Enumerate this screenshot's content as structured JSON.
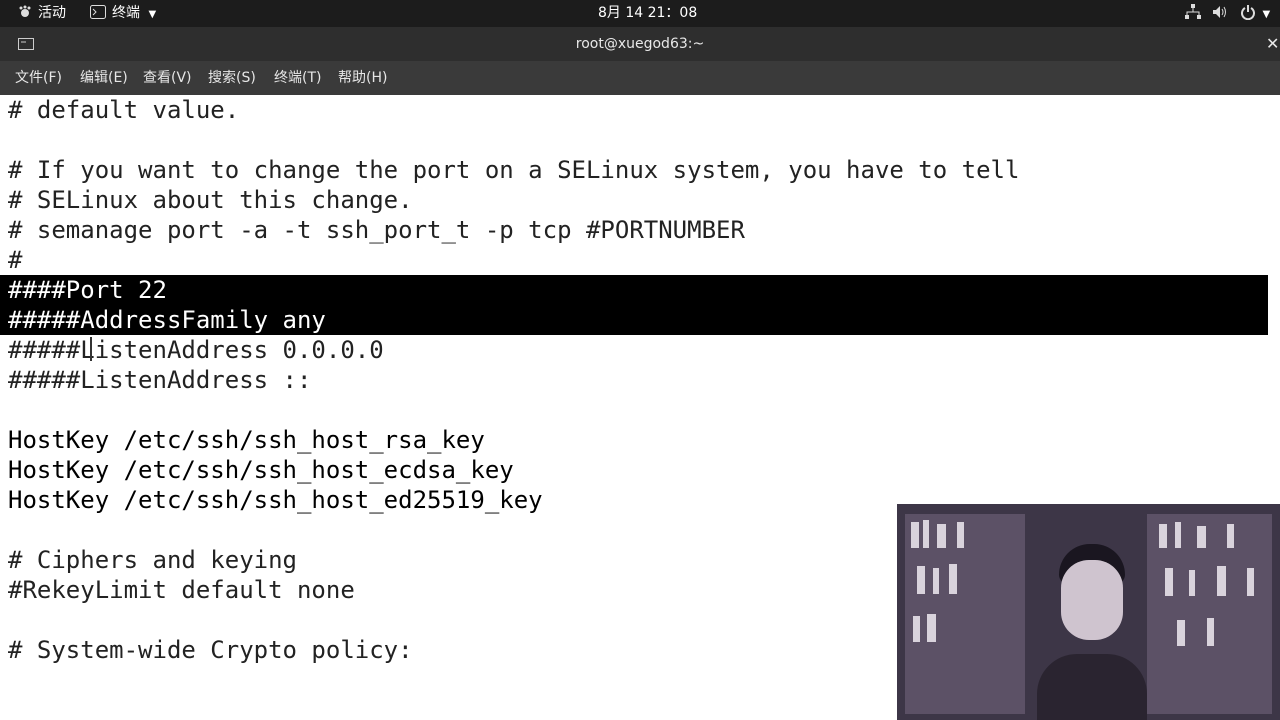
{
  "topbar": {
    "activities": "活动",
    "app_menu": "终端",
    "clock": "8月 14  21：08"
  },
  "window": {
    "title": "root@xuegod63:~"
  },
  "menu": [
    "文件(F)",
    "编辑(E)",
    "查看(V)",
    "搜索(S)",
    "终端(T)",
    "帮助(H)"
  ],
  "terminal": {
    "lines": [
      "# default value.",
      "",
      "# If you want to change the port on a SELinux system, you have to tell",
      "# SELinux about this change.",
      "# semanage port -a -t ssh_port_t -p tcp #PORTNUMBER",
      "#",
      "####Port 22",
      "#####AddressFamily any",
      "#####ListenAddress 0.0.0.0",
      "#####ListenAddress ::",
      "",
      "HostKey /etc/ssh/ssh_host_rsa_key",
      "HostKey /etc/ssh/ssh_host_ecdsa_key",
      "HostKey /etc/ssh/ssh_host_ed25519_key",
      "",
      "# Ciphers and keying",
      "#RekeyLimit default none",
      "",
      "# System-wide Crypto policy:"
    ]
  },
  "colors": {
    "topbar_bg": "#1c1c1c",
    "titlebar_bg": "#2e2e2e",
    "menubar_bg": "#3a3a3a",
    "selection_bg": "#000000",
    "terminal_bg": "#ffffff"
  }
}
